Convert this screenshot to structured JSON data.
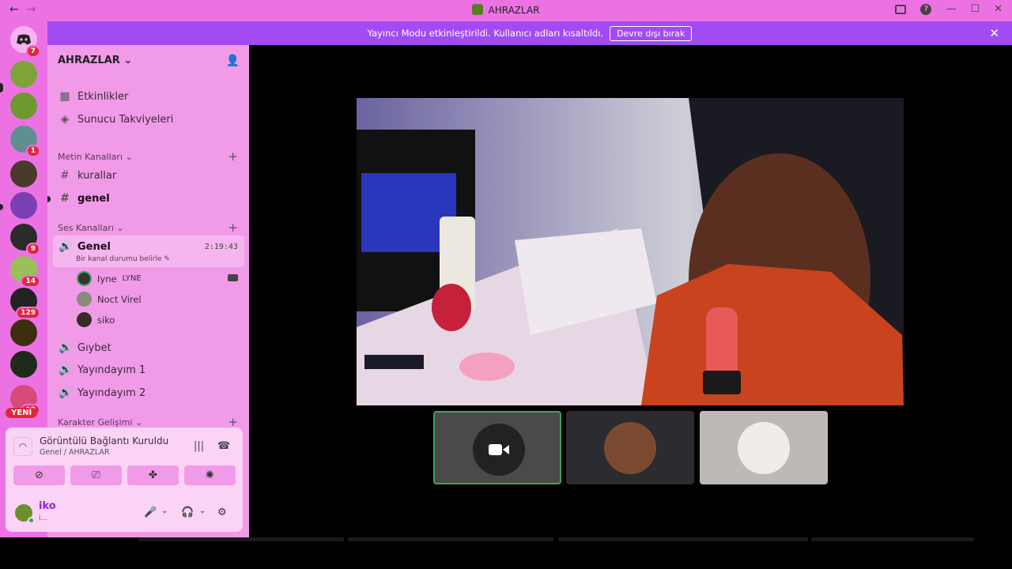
{
  "window": {
    "title": "AHRAZLAR",
    "nav_back": "←",
    "nav_forward": "→",
    "help": "?",
    "minimize": "—",
    "maximize": "☐",
    "close": "✕"
  },
  "banner": {
    "message": "Yayıncı Modu etkinleştirildi. Kullanıcı adları kısaltıldı.",
    "button": "Devre dışı bırak",
    "close": "✕"
  },
  "rail": {
    "home_badge": "7",
    "badge_dm": "1",
    "badge_a": "9",
    "badge_b": "14",
    "badge_c": "129",
    "badge_d": "13",
    "new_label": "YENİ"
  },
  "sidebar": {
    "server_name": "AHRAZLAR",
    "items": [
      {
        "label": "Etkinlikler",
        "icon": "calendar-icon"
      },
      {
        "label": "Sunucu Takviyeleri",
        "icon": "boost-icon"
      }
    ],
    "text_category": "Metin Kanalları",
    "text_channels": [
      "kurallar",
      "genel"
    ],
    "voice_category": "Ses Kanalları",
    "active_voice": {
      "name": "Genel",
      "time": "2:19:43",
      "status": "Bir kanal durumu belirle"
    },
    "voice_users": [
      {
        "name": "Iyne",
        "tag": "LYNE"
      },
      {
        "name": "Noct Virel"
      },
      {
        "name": "siko"
      }
    ],
    "voice_channels": [
      "Gıybet",
      "Yayındayım 1",
      "Yayındayım 2"
    ],
    "extra_category": "Karakter Gelişimi"
  },
  "panel": {
    "connection_title": "Görüntülü Bağlantı Kuruldu",
    "connection_sub": "Genel / AHRAZLAR",
    "user_name": "iko",
    "user_sub": "i..."
  },
  "colors": {
    "titlebar": "#ec72e4",
    "banner": "#a24bf2",
    "sidebar": "#f19ae8",
    "panel": "#fbd3f7",
    "speaking": "#3ba55c"
  }
}
